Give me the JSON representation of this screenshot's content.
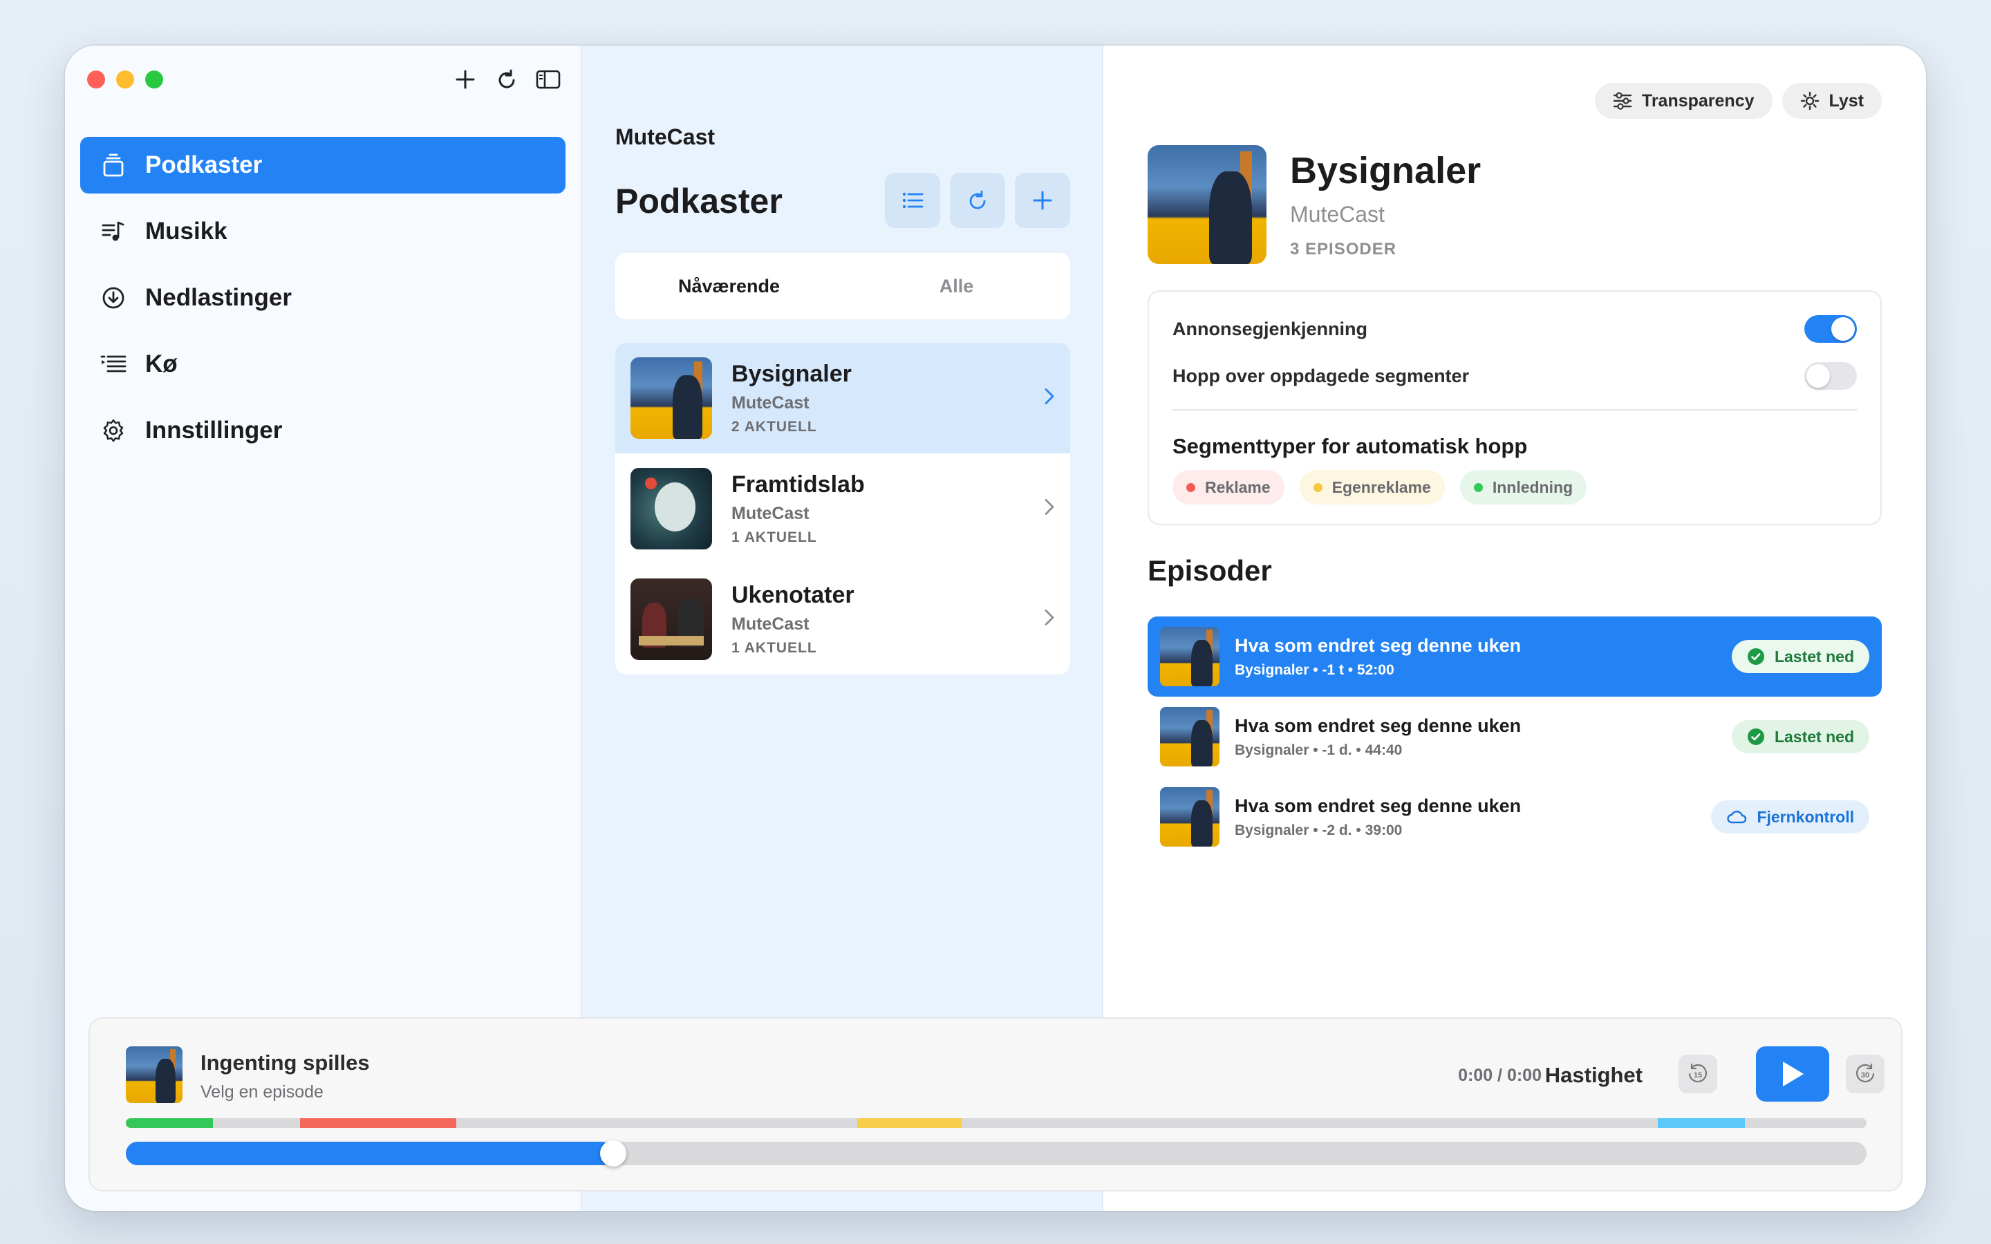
{
  "sidebar": {
    "items": [
      {
        "label": "Podkaster",
        "icon": "podcast-icon",
        "active": true
      },
      {
        "label": "Musikk",
        "icon": "music-icon"
      },
      {
        "label": "Nedlastinger",
        "icon": "download-icon"
      },
      {
        "label": "Kø",
        "icon": "queue-icon"
      },
      {
        "label": "Innstillinger",
        "icon": "gear-icon"
      }
    ]
  },
  "middle": {
    "app_name": "MuteCast",
    "title": "Podkaster",
    "tabs": [
      {
        "label": "Nåværende",
        "active": true
      },
      {
        "label": "Alle"
      }
    ],
    "podcasts": [
      {
        "title": "Bysignaler",
        "publisher": "MuteCast",
        "count": "2 AKTUELL"
      },
      {
        "title": "Framtidslab",
        "publisher": "MuteCast",
        "count": "1 AKTUELL"
      },
      {
        "title": "Ukenotater",
        "publisher": "MuteCast",
        "count": "1 AKTUELL"
      }
    ]
  },
  "detail": {
    "pills": {
      "transparency": "Transparency",
      "theme": "Lyst"
    },
    "podcast": {
      "title": "Bysignaler",
      "publisher": "MuteCast",
      "count": "3 EPISODER"
    },
    "settings": {
      "ad_detection_label": "Annonsegjenkjenning",
      "ad_detection_on": true,
      "skip_label": "Hopp over oppdagede segmenter",
      "skip_on": false,
      "segment_types_title": "Segmenttyper for automatisk hopp",
      "tags": [
        {
          "label": "Reklame",
          "color": "#f25c54",
          "bg": "#fdeceb"
        },
        {
          "label": "Egenreklame",
          "color": "#f5c842",
          "bg": "#fdf6e0"
        },
        {
          "label": "Innledning",
          "color": "#34c759",
          "bg": "#e6f6ea"
        }
      ]
    },
    "episodes_title": "Episoder",
    "episodes": [
      {
        "title": "Hva som endret seg denne uken",
        "meta": "Bysignaler • -1 t • 52:00",
        "badge": "Lastet ned",
        "badge_type": "dl",
        "active": true
      },
      {
        "title": "Hva som endret seg denne uken",
        "meta": "Bysignaler • -1 d. • 44:40",
        "badge": "Lastet ned",
        "badge_type": "dl"
      },
      {
        "title": "Hva som endret seg denne uken",
        "meta": "Bysignaler • -2 d. • 39:00",
        "badge": "Fjernkontroll",
        "badge_type": "remote"
      }
    ]
  },
  "player": {
    "title": "Ingenting spilles",
    "subtitle": "Velg en episode",
    "time": "0:00 / 0:00",
    "speed_label": "Hastighet",
    "skip_back": "15",
    "skip_forward": "30",
    "progress_fraction": 0.28,
    "segments": [
      {
        "start": 0.0,
        "end": 0.05,
        "color": "#34c759"
      },
      {
        "start": 0.1,
        "end": 0.19,
        "color": "#f4675b"
      },
      {
        "start": 0.42,
        "end": 0.48,
        "color": "#f7cf4a"
      },
      {
        "start": 0.88,
        "end": 0.93,
        "color": "#5ac8fa"
      }
    ]
  },
  "colors": {
    "accent": "#2383f5"
  }
}
